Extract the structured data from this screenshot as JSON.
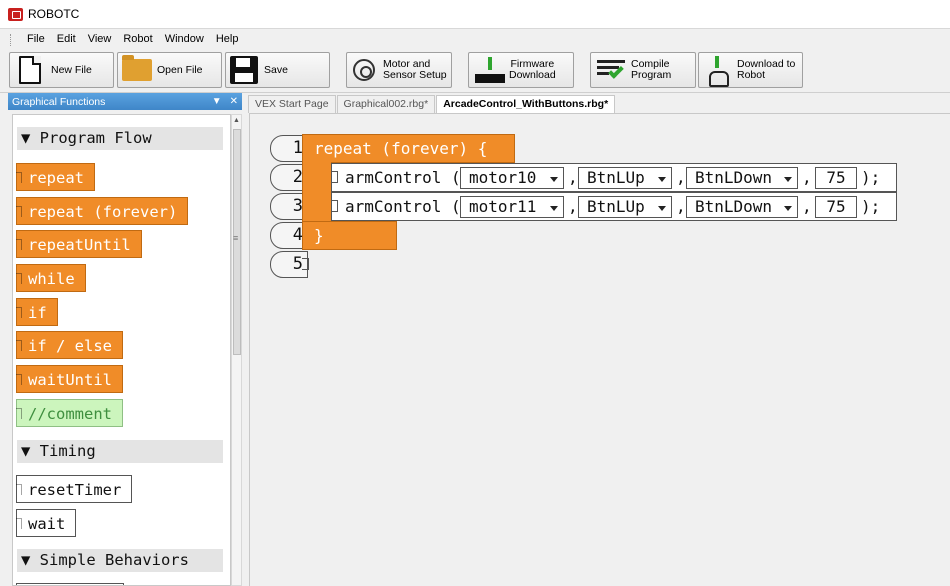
{
  "window": {
    "title": "ROBOTC"
  },
  "menu": [
    "File",
    "Edit",
    "View",
    "Robot",
    "Window",
    "Help"
  ],
  "toolbar": {
    "new_file": "New File",
    "open_file": "Open File",
    "save": "Save",
    "motor_setup": [
      "Motor and",
      "Sensor Setup"
    ],
    "firmware": [
      "Firmware",
      "Download"
    ],
    "compile": [
      "Compile",
      "Program"
    ],
    "download": [
      "Download to",
      "Robot"
    ]
  },
  "panel": {
    "title": "Graphical Functions",
    "sections": {
      "program_flow": "▼ Program Flow",
      "timing": "▼ Timing",
      "simple_behaviors": "▼ Simple Behaviors"
    },
    "program_flow_blocks": [
      "repeat",
      "repeat (forever)",
      "repeatUntil",
      "while",
      "if",
      "if / else",
      "waitUntil",
      "//comment"
    ],
    "timing_blocks": [
      "resetTimer",
      "wait"
    ]
  },
  "tabs": [
    "VEX Start Page",
    "Graphical002.rbg*",
    "ArcadeControl_WithButtons.rbg*"
  ],
  "program": {
    "line_numbers": [
      "1",
      "2",
      "3",
      "4",
      "5"
    ],
    "repeat_header": "repeat (forever) {",
    "close_brace": "}",
    "statements": [
      {
        "func": "armControl (",
        "motor": "motor10",
        "up": "BtnLUp",
        "down": "BtnLDown",
        "speed": "75",
        "sep": ",",
        "end": ");"
      },
      {
        "func": "armControl (",
        "motor": "motor11",
        "up": "BtnLUp",
        "down": "BtnLDown",
        "speed": "75",
        "sep": ",",
        "end": ");"
      }
    ]
  }
}
